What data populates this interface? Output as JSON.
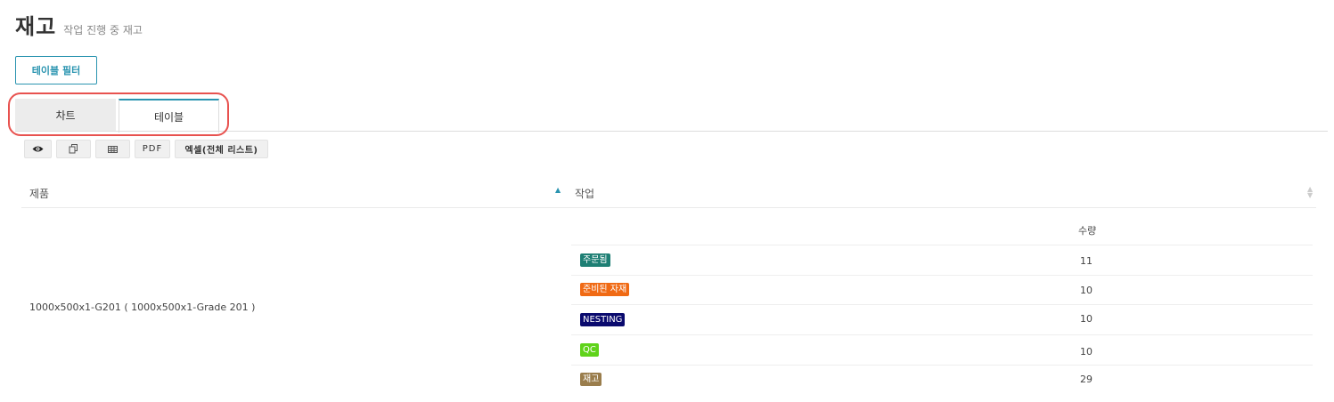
{
  "header": {
    "title": "재고",
    "subtitle": "작업 진행 중 재고"
  },
  "filter_button": "테이블 필터",
  "tabs": [
    {
      "label": "차트",
      "active": false
    },
    {
      "label": "테이블",
      "active": true
    }
  ],
  "toolbar": {
    "view_icon": "eye-icon",
    "copy_icon": "copy-icon",
    "csv_icon": "grid-icon",
    "pdf_label": "PDF",
    "excel_label": "엑셀(전체 리스트)"
  },
  "table": {
    "columns": [
      "제품",
      "작업"
    ],
    "sort": {
      "column": "제품",
      "direction": "asc"
    },
    "rows": [
      {
        "product": "1000x500x1-G201 ( 1000x500x1-Grade 201 )",
        "tasks_header": "수량",
        "tasks": [
          {
            "status": "주문됨",
            "color": "#1e7f74",
            "quantity": "11"
          },
          {
            "status": "준비된 자재",
            "color": "#f06a14",
            "quantity": "10"
          },
          {
            "status": "NESTING",
            "color": "#0a0a6e",
            "quantity": "10"
          },
          {
            "status": "QC",
            "color": "#5fd31a",
            "quantity": "10"
          },
          {
            "status": "재고",
            "color": "#9a7d4c",
            "quantity": "29"
          }
        ]
      }
    ]
  },
  "colors": {
    "accent": "#2a94b0",
    "highlight": "#e8524f"
  }
}
